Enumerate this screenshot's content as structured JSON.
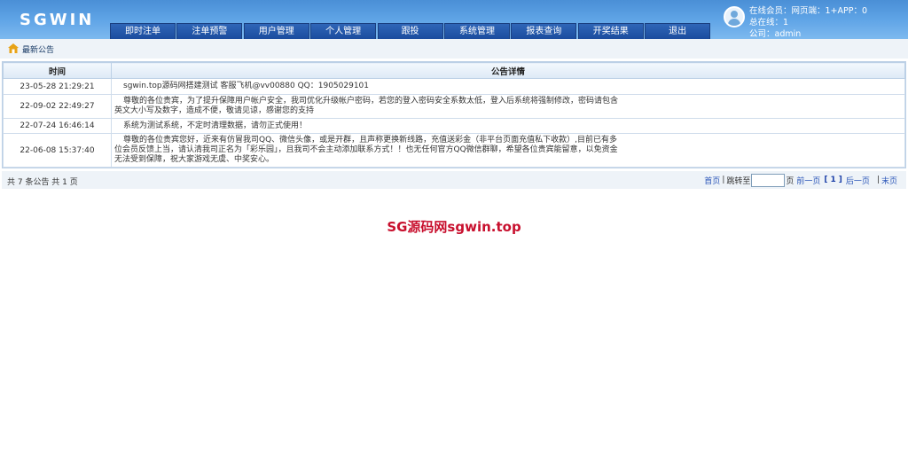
{
  "header": {
    "logo": "SGWIN",
    "nav": [
      "即时注单",
      "注单预警",
      "用户管理",
      "个人管理",
      "跟投",
      "系统管理",
      "报表查询",
      "开奖结果",
      "退出"
    ],
    "user_info": {
      "line1": "在线会员：网页端：1+APP：0",
      "line2": "总在线：1",
      "line3": "公司：admin"
    }
  },
  "breadcrumb": {
    "label": "最新公告"
  },
  "table": {
    "headers": {
      "time": "时间",
      "detail": "公告详情"
    },
    "rows": [
      {
        "time": "23-05-28 21:29:21",
        "detail": "sgwin.top源码网搭建测试 客服飞机@vv00880 QQ：1905029101"
      },
      {
        "time": "22-09-02 22:49:27",
        "detail": "尊敬的各位贵宾，为了提升保障用户帐户安全，我司优化升级帐户密码，若您的登入密码安全系数太低，登入后系统将强制修改，密码请包含英文大小写及数字，造成不便，敬请见谅，感谢您的支持"
      },
      {
        "time": "22-07-24 16:46:14",
        "detail": "系统为测试系统，不定时清理数据，请勿正式使用！"
      },
      {
        "time": "22-06-08 15:37:40",
        "detail": "尊敬的各位贵宾您好，近来有仿冒我司QQ、微信头像，或是开群，且声称更换新线路，充值送彩金（非平台页面充值私下收款）,目前已有多位会员反馈上当，请认清我司正名为「彩乐园」，且我司不会主动添加联系方式！！也无任何官方QQ微信群聊，希望各位贵宾能留意，以免资金无法受到保障，祝大家游戏无虞、中奖安心。"
      }
    ]
  },
  "footer": {
    "total": "共 7 条公告 共 1 页",
    "first": "首页",
    "jump_label": "跳转至",
    "page_unit": "页",
    "prev": "前一页",
    "current_page": "1",
    "next": "后一页",
    "last": "末页"
  },
  "watermark": "SG源码网sgwin.top",
  "colors": {
    "header": "#5fa4e6",
    "nav": "#1b4c9e",
    "watermark": "#c8102e",
    "link": "#2a55b8"
  },
  "icons": {
    "home": "home-icon",
    "avatar": "user-avatar-icon"
  }
}
